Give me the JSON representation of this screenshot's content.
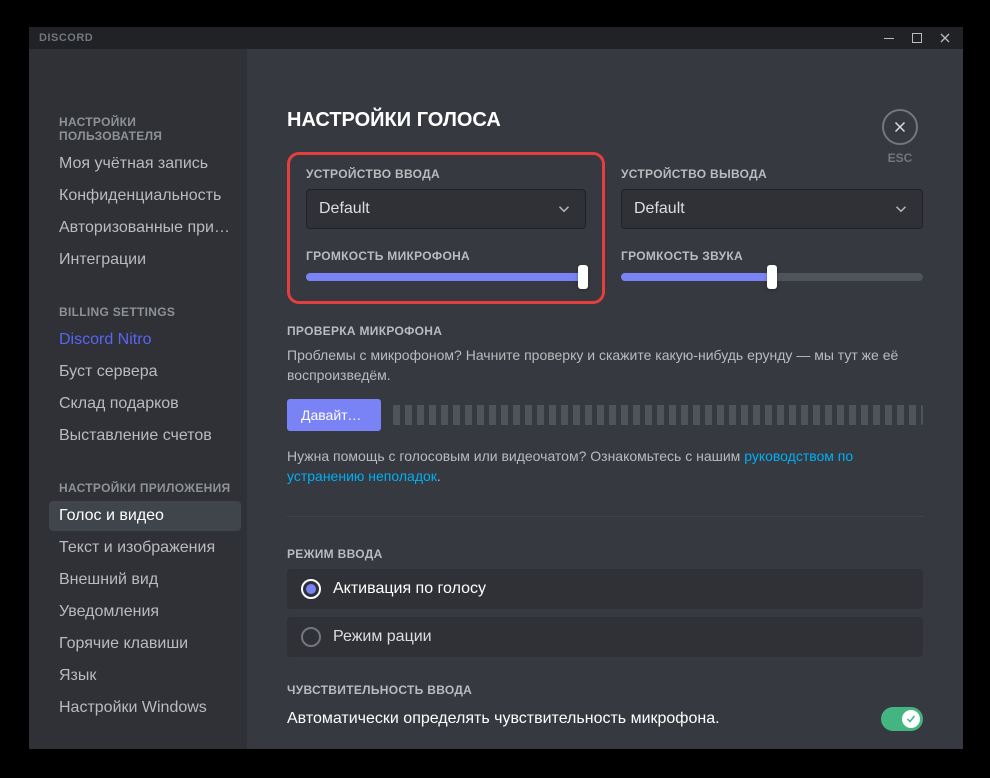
{
  "titlebar": {
    "app_name": "DISCORD"
  },
  "close": {
    "label": "ESC"
  },
  "sidebar": {
    "sections": [
      {
        "heading": "НАСТРОЙКИ ПОЛЬЗОВАТЕЛЯ",
        "items": [
          {
            "label": "Моя учётная запись"
          },
          {
            "label": "Конфиденциальность"
          },
          {
            "label": "Авторизованные прил..."
          },
          {
            "label": "Интеграции"
          }
        ]
      },
      {
        "heading": "BILLING SETTINGS",
        "items": [
          {
            "label": "Discord Nitro",
            "nitro": true
          },
          {
            "label": "Буст сервера"
          },
          {
            "label": "Склад подарков"
          },
          {
            "label": "Выставление счетов"
          }
        ]
      },
      {
        "heading": "НАСТРОЙКИ ПРИЛОЖЕНИЯ",
        "items": [
          {
            "label": "Голос и видео",
            "active": true
          },
          {
            "label": "Текст и изображения"
          },
          {
            "label": "Внешний вид"
          },
          {
            "label": "Уведомления"
          },
          {
            "label": "Горячие клавиши"
          },
          {
            "label": "Язык"
          },
          {
            "label": "Настройки Windows"
          }
        ]
      }
    ]
  },
  "page": {
    "title": "НАСТРОЙКИ ГОЛОСА",
    "input_device": {
      "label": "УСТРОЙСТВО ВВОДА",
      "value": "Default"
    },
    "output_device": {
      "label": "УСТРОЙСТВО ВЫВОДА",
      "value": "Default"
    },
    "mic_volume": {
      "label": "ГРОМКОСТЬ МИКРОФОНА",
      "percent": 100
    },
    "output_volume": {
      "label": "ГРОМКОСТЬ ЗВУКА",
      "percent": 50
    },
    "mic_test": {
      "heading": "ПРОВЕРКА МИКРОФОНА",
      "desc": "Проблемы с микрофоном? Начните проверку и скажите какую-нибудь ерунду — мы тут же её воспроизведём.",
      "button": "Давайте пр...",
      "help_pre": "Нужна помощь с голосовым или видеочатом? Ознакомьтесь с нашим ",
      "help_link": "руководством по устранению неполадок",
      "help_post": "."
    },
    "input_mode": {
      "heading": "РЕЖИМ ВВОДА",
      "options": [
        {
          "label": "Активация по голосу",
          "selected": true
        },
        {
          "label": "Режим рации",
          "selected": false
        }
      ]
    },
    "sensitivity": {
      "heading": "ЧУВСТВИТЕЛЬНОСТЬ ВВОДА",
      "label": "Автоматически определять чувствительность микрофона."
    }
  }
}
